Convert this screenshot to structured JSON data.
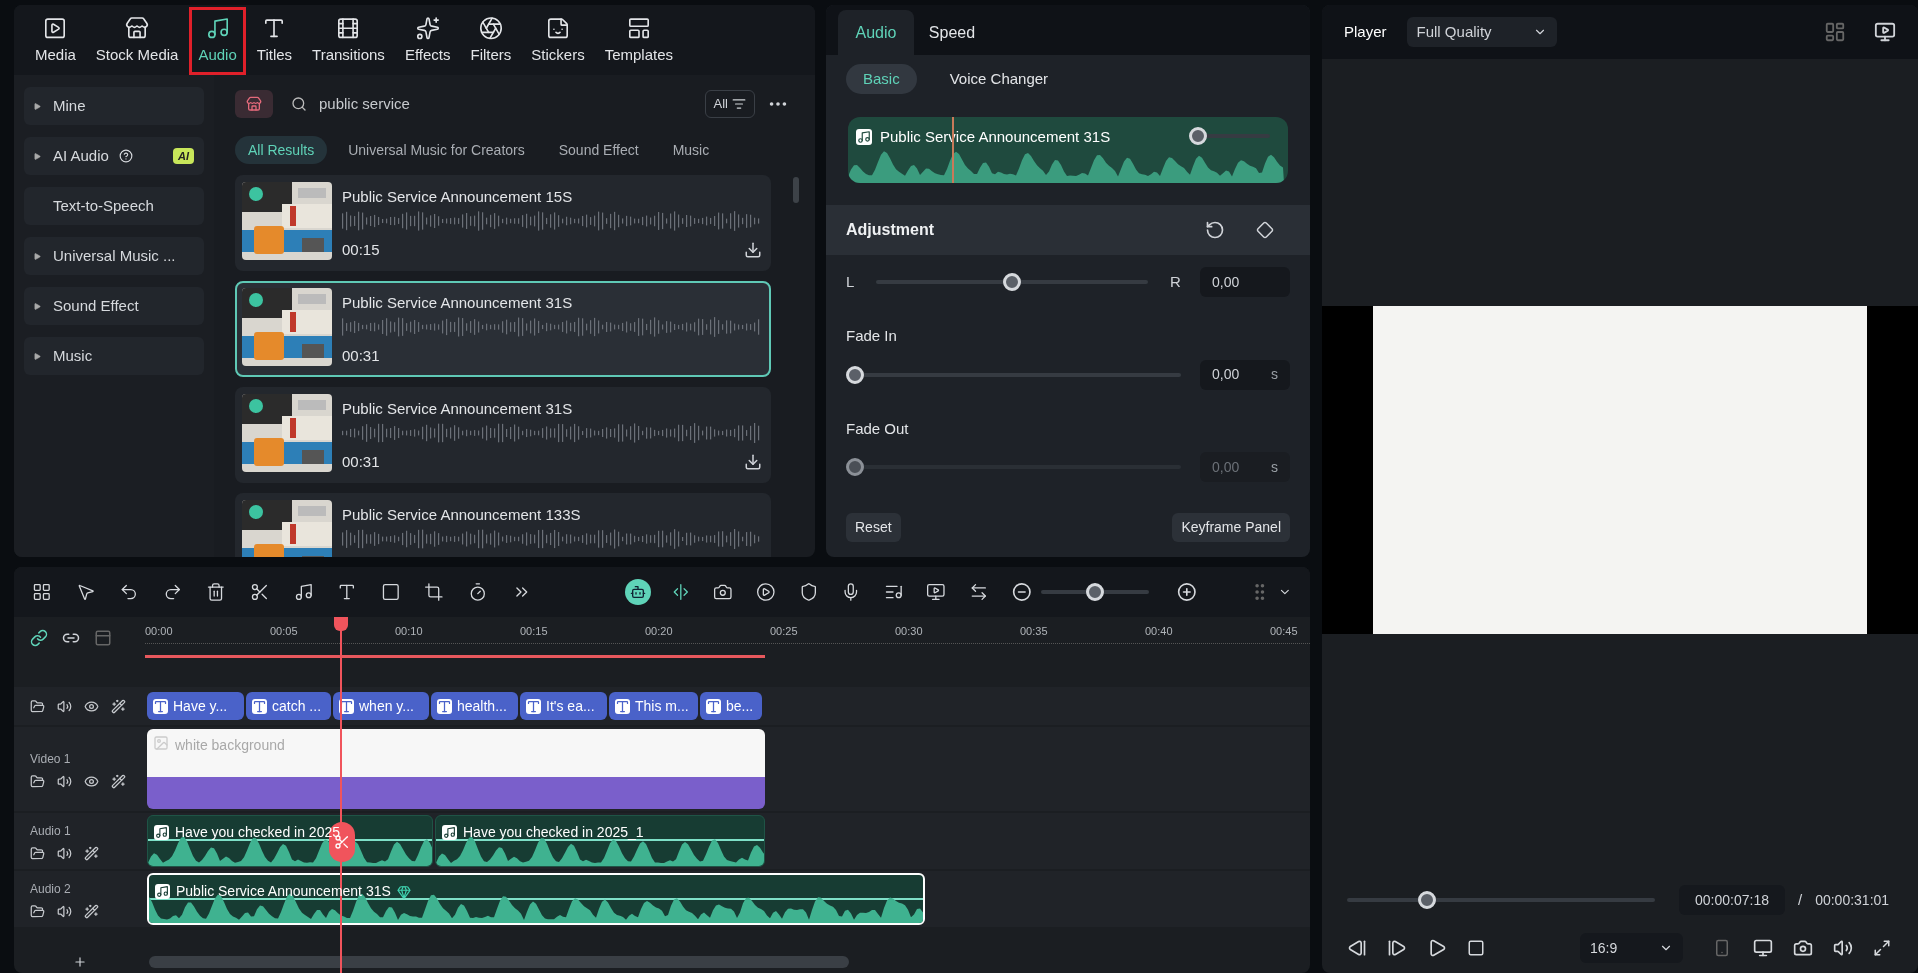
{
  "nav_tabs": [
    {
      "label": "Media",
      "selected": false,
      "highlighted": false
    },
    {
      "label": "Stock Media",
      "selected": false,
      "highlighted": false
    },
    {
      "label": "Audio",
      "selected": true,
      "highlighted": true
    },
    {
      "label": "Titles",
      "selected": false,
      "highlighted": false
    },
    {
      "label": "Transitions",
      "selected": false,
      "highlighted": false
    },
    {
      "label": "Effects",
      "selected": false,
      "highlighted": false
    },
    {
      "label": "Filters",
      "selected": false,
      "highlighted": false
    },
    {
      "label": "Stickers",
      "selected": false,
      "highlighted": false
    },
    {
      "label": "Templates",
      "selected": false,
      "highlighted": false
    }
  ],
  "sidebar": {
    "items": [
      {
        "label": "Mine",
        "kind": "group"
      },
      {
        "label": "AI Audio",
        "kind": "group",
        "help": true,
        "badge": "AI"
      },
      {
        "label": "Text-to-Speech",
        "kind": "item"
      },
      {
        "label": "Universal Music ...",
        "kind": "group"
      },
      {
        "label": "Sound Effect",
        "kind": "group"
      },
      {
        "label": "Music",
        "kind": "group"
      }
    ]
  },
  "search": {
    "value": "public service",
    "filter": "All"
  },
  "filter_tabs": [
    {
      "label": "All Results",
      "selected": true
    },
    {
      "label": "Universal Music for Creators",
      "selected": false
    },
    {
      "label": "Sound Effect",
      "selected": false
    },
    {
      "label": "Music",
      "selected": false
    }
  ],
  "results": [
    {
      "title": "Public Service Announcement 15S",
      "duration": "00:15",
      "selected": false,
      "downloadable": true
    },
    {
      "title": "Public Service Announcement 31S",
      "duration": "00:31",
      "selected": true,
      "downloadable": false
    },
    {
      "title": "Public Service Announcement 31S",
      "duration": "00:31",
      "selected": false,
      "downloadable": true
    },
    {
      "title": "Public Service Announcement 133S",
      "selected": false
    }
  ],
  "properties": {
    "tabs": [
      {
        "label": "Audio",
        "selected": true
      },
      {
        "label": "Speed",
        "selected": false
      }
    ],
    "subtabs": [
      {
        "label": "Basic",
        "selected": true
      },
      {
        "label": "Voice Changer",
        "selected": false
      }
    ],
    "clip": {
      "title": "Public Service Announcement 31S",
      "level": 0.08
    },
    "adjustment": {
      "title": "Adjustment",
      "balance": {
        "left": "L",
        "right": "R",
        "level": 0.5,
        "value": "0,00"
      },
      "fades": [
        {
          "label": "Fade In",
          "level": 0,
          "value": "0,00",
          "unit": "s",
          "disabled": false
        },
        {
          "label": "Fade Out",
          "level": 0,
          "value": "0,00",
          "unit": "s",
          "disabled": true
        }
      ]
    },
    "buttons": [
      "Reset",
      "Keyframe Panel"
    ]
  },
  "player": {
    "label": "Player",
    "quality": "Full Quality",
    "progress": {
      "level": 0.26
    },
    "current_time": "00:00:07:18",
    "separator": "/",
    "total_time": "00:00:31:01",
    "aspect": "16:9"
  },
  "timeline": {
    "zoom": {
      "level": 0.5
    },
    "ruler": [
      "00:00",
      "00:05",
      "00:10",
      "00:15",
      "00:20",
      "00:25",
      "00:30",
      "00:35",
      "00:40",
      "00:45"
    ],
    "tracks": [
      {
        "kind": "title",
        "clips": [
          {
            "label": "Have y...",
            "selected": false
          },
          {
            "label": "catch ...",
            "selected": false
          },
          {
            "label": "when y...",
            "selected": false
          },
          {
            "label": "health...",
            "selected": false
          },
          {
            "label": "It's ea...",
            "selected": false
          },
          {
            "label": "This m...",
            "selected": false
          },
          {
            "label": "be...",
            "selected": false
          }
        ]
      },
      {
        "kind": "video",
        "name": "Video 1",
        "clips": [
          {
            "label": "white background",
            "selected": false
          }
        ]
      },
      {
        "kind": "audio",
        "name": "Audio 1",
        "clips": [
          {
            "label": "Have you checked in  2025",
            "selected": false
          },
          {
            "label": "Have you checked in  2025_1",
            "selected": false
          }
        ]
      },
      {
        "kind": "audio",
        "name": "Audio 2",
        "clips": [
          {
            "label": "Public Service Announcement 31S",
            "selected": true,
            "premium": true
          }
        ]
      }
    ]
  }
}
